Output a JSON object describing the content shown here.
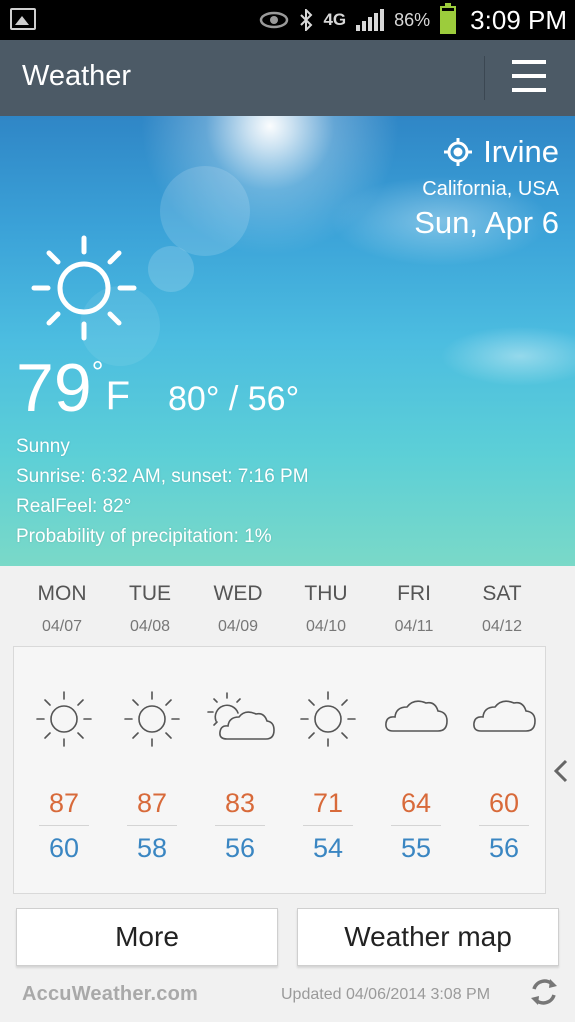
{
  "status_bar": {
    "battery_text": "86%",
    "battery_level": 0.86,
    "network": "4G",
    "time": "3:09 PM",
    "icons": [
      "image-notification-icon",
      "eye-icon",
      "bluetooth-icon",
      "network-4g-icon",
      "signal-icon",
      "battery-icon"
    ]
  },
  "header": {
    "title": "Weather",
    "menu_icon": "hamburger-menu-icon"
  },
  "current": {
    "city": "Irvine",
    "region": "California, USA",
    "date": "Sun, Apr 6",
    "temp": "79",
    "temp_deg": "°",
    "temp_unit": "F",
    "hilo": "80° / 56°",
    "condition": "Sunny",
    "sun_times": "Sunrise: 6:32  AM, sunset: 7:16  PM",
    "realfeel": "RealFeel: 82°",
    "precip": "Probability of precipitation: 1%",
    "icon": "sun-icon"
  },
  "forecast": [
    {
      "day": "MON",
      "date": "04/07",
      "high": "87",
      "low": "60",
      "icon": "sunny"
    },
    {
      "day": "TUE",
      "date": "04/08",
      "high": "87",
      "low": "58",
      "icon": "sunny"
    },
    {
      "day": "WED",
      "date": "04/09",
      "high": "83",
      "low": "56",
      "icon": "partly-cloudy"
    },
    {
      "day": "THU",
      "date": "04/10",
      "high": "71",
      "low": "54",
      "icon": "sunny"
    },
    {
      "day": "FRI",
      "date": "04/11",
      "high": "64",
      "low": "55",
      "icon": "cloudy"
    },
    {
      "day": "SAT",
      "date": "04/12",
      "high": "60",
      "low": "56",
      "icon": "cloudy"
    }
  ],
  "buttons": {
    "more": "More",
    "map": "Weather map"
  },
  "footer": {
    "brand": "AccuWeather.com",
    "updated": "Updated 04/06/2014 3:08 PM"
  },
  "colors": {
    "header_bg": "#4c5a66",
    "high_temp": "#d86a3a",
    "low_temp": "#3a86c2",
    "battery": "#9ccc3c"
  }
}
